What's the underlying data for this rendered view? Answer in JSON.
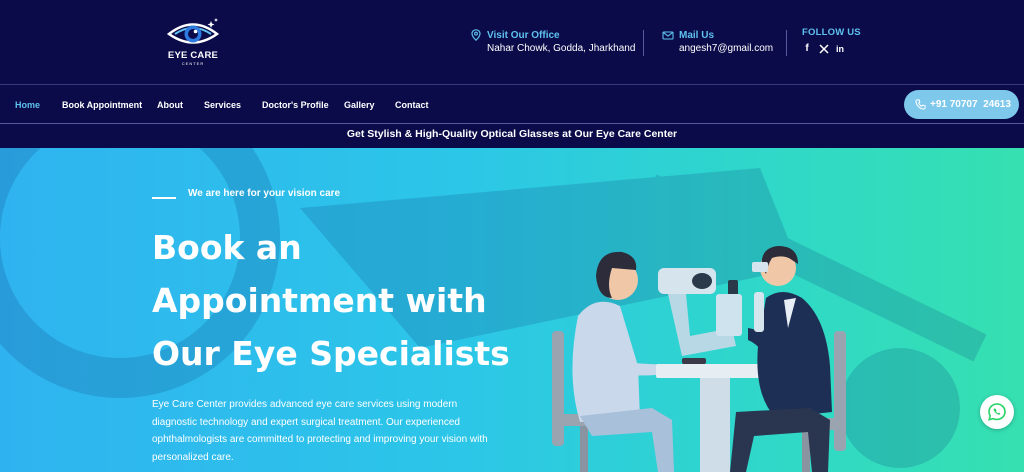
{
  "brand": {
    "name": "EYE CARE",
    "sub": "CENTER"
  },
  "contact": {
    "office_title": "Visit Our Office",
    "office_address": "Nahar Chowk, Godda, Jharkhand",
    "mail_title": "Mail Us",
    "mail_address": "angesh7@gmail.com",
    "follow_title": "FOLLOW US",
    "social": [
      "facebook-icon",
      "x-icon",
      "linkedin-icon"
    ]
  },
  "nav": {
    "items": [
      {
        "label": "Home",
        "active": true
      },
      {
        "label": "Book Appointment"
      },
      {
        "label": "About"
      },
      {
        "label": "Services"
      },
      {
        "label": "Doctor's Profile"
      },
      {
        "label": "Gallery"
      },
      {
        "label": "Contact"
      }
    ],
    "phone": "+91 70707  24613"
  },
  "promo": "Get Stylish & High-Quality Optical Glasses at Our Eye Care Center",
  "hero": {
    "tagline": "We are here for your vision care",
    "headline": [
      "Book an",
      "Appointment with",
      "Our Eye Specialists"
    ],
    "description": "Eye Care Center provides advanced eye care services using modern diagnostic technology and expert surgical treatment. Our experienced ophthalmologists are committed to protecting and improving your vision with personalized care."
  },
  "colors": {
    "header_bg": "#0b0b4a",
    "accent": "#5fc1ee",
    "hero_start": "#2fb3f0",
    "hero_end": "#36e0b0",
    "whatsapp": "#25d366"
  }
}
